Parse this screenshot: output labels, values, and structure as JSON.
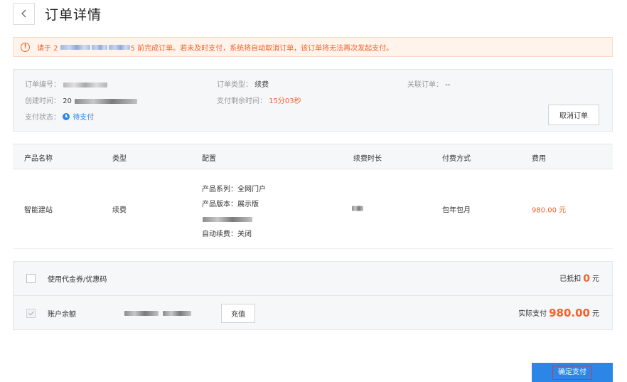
{
  "header": {
    "title": "订单详情"
  },
  "notice": {
    "prefix": "请于 2",
    "suffix": "5 前完成订单。若未及时支付，系统将自动取消订单，该订单将无法再次发起支付。"
  },
  "order_info": {
    "order_no_label": "订单编号：",
    "created_label": "创建时间：",
    "created_value": "20",
    "status_label": "支付状态：",
    "status_value": "待支付",
    "order_type_label": "订单类型：",
    "order_type_value": "续费",
    "remaining_label": "支付剩余时间：",
    "remaining_value": "15分03秒",
    "related_label": "关联订单：",
    "related_value": "--",
    "cancel_label": "取消订单"
  },
  "table": {
    "headers": [
      "产品名称",
      "类型",
      "配置",
      "续费时长",
      "付费方式",
      "费用"
    ],
    "row": {
      "name": "智能建站",
      "type": "续费",
      "config": {
        "series": "产品系列：全网门户",
        "version": "产品版本：展示版",
        "auto_renew": "自动续费：关闭"
      },
      "payment": "包年包月",
      "fee": "980.00 元"
    }
  },
  "payment": {
    "coupon_label": "使用代金券/优惠码",
    "deducted_prefix": "已抵扣",
    "deducted_value": "0",
    "deducted_unit": "元",
    "balance_label": "账户余额",
    "recharge_label": "充值",
    "actual_prefix": "实际支付",
    "actual_value": "980.00",
    "actual_unit": "元"
  },
  "confirm_label": "确定支付"
}
